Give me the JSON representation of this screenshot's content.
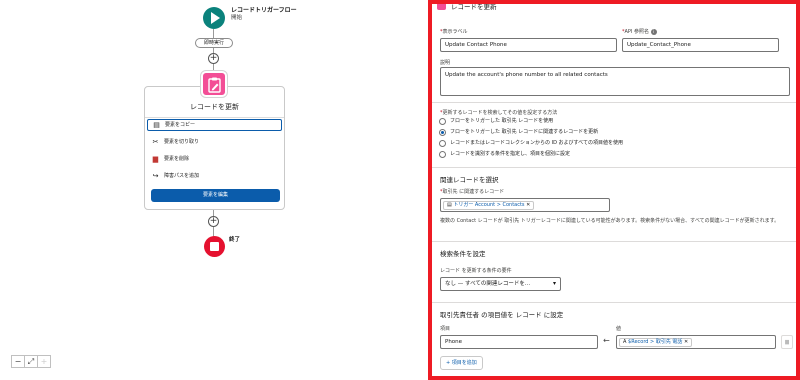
{
  "canvas": {
    "start_title": "レコードトリガーフロー",
    "start_subtitle": "開始",
    "run_immediately": "即時実行",
    "element_title": "レコードを更新",
    "menu_items": [
      {
        "label": "要素をコピー",
        "icon": "copy-icon"
      },
      {
        "label": "要素を切り取り",
        "icon": "scissors-icon"
      },
      {
        "label": "要素を削除",
        "icon": "trash-icon"
      },
      {
        "label": "障害パスを追加",
        "icon": "fault-path-icon"
      }
    ],
    "edit_button": "要素を編集",
    "end_label": "終了",
    "zoom": {
      "minus": "−",
      "fit": "⤢",
      "plus": "+"
    }
  },
  "panel": {
    "title": "レコードを更新",
    "label_label": "表示ラベル",
    "label_value": "Update Contact Phone",
    "api_label": "API 参照名",
    "api_value": "Update_Contact_Phone",
    "desc_label": "説明",
    "desc_value": "Update the account's phone number to all related contacts",
    "method_label": "更新するレコードを検索してその値を設定する方法",
    "radio_options": [
      {
        "label": "フローをトリガーした 取引先 レコードを使用",
        "selected": false
      },
      {
        "label": "フローをトリガーした 取引先 レコードに関連するレコードを更新",
        "selected": true
      },
      {
        "label": "レコードまたはレコードコレクションからの ID およびすべての項目値を使用",
        "selected": false
      },
      {
        "label": "レコードを識別する条件を指定し、項目を個別に設定",
        "selected": false
      }
    ],
    "related_section": "関連レコードを選択",
    "related_label": "取引先 に関連するレコード",
    "related_pill": "トリガー Account > Contacts",
    "related_note": "複数の Contact レコードが 取引先 トリガーレコードに関連している可能性があります。検索条件がない場合、すべての関連レコードが更新されます。",
    "filter_section": "検索条件を設定",
    "filter_label": "レコード を更新する条件の要件",
    "filter_value": "なし — すべての関連レコードを...",
    "set_section": "取引先責任者 の項目値を レコード に設定",
    "field_label": "項目",
    "field_value": "Phone",
    "value_label": "値",
    "value_pill": "$Record > 取引先 電話",
    "add_field": "項目を追加",
    "accent": "#0b5cab",
    "highlight": "#ee1b24"
  }
}
